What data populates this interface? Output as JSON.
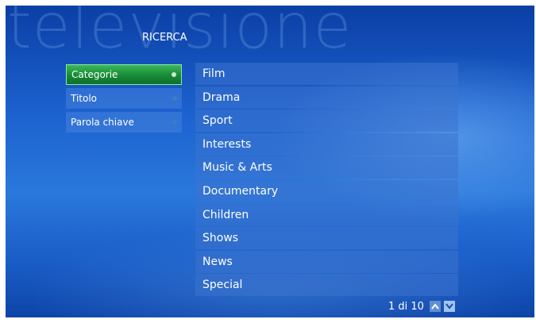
{
  "header": {
    "watermark": "televisione",
    "section_title": "RICERCA"
  },
  "search_types": [
    {
      "label": "Categorie",
      "active": true
    },
    {
      "label": "Titolo",
      "active": false
    },
    {
      "label": "Parola chiave",
      "active": false
    }
  ],
  "categories": [
    {
      "label": "Film"
    },
    {
      "label": "Drama"
    },
    {
      "label": "Sport"
    },
    {
      "label": "Interests"
    },
    {
      "label": "Music & Arts"
    },
    {
      "label": "Documentary"
    },
    {
      "label": "Children"
    },
    {
      "label": "Shows"
    },
    {
      "label": "News"
    },
    {
      "label": "Special"
    }
  ],
  "pager": {
    "text": "1 di 10",
    "up_icon": "chevron-up-icon",
    "down_icon": "chevron-down-icon"
  },
  "colors": {
    "background": "#1c62cf",
    "active_item": "#178a36"
  }
}
